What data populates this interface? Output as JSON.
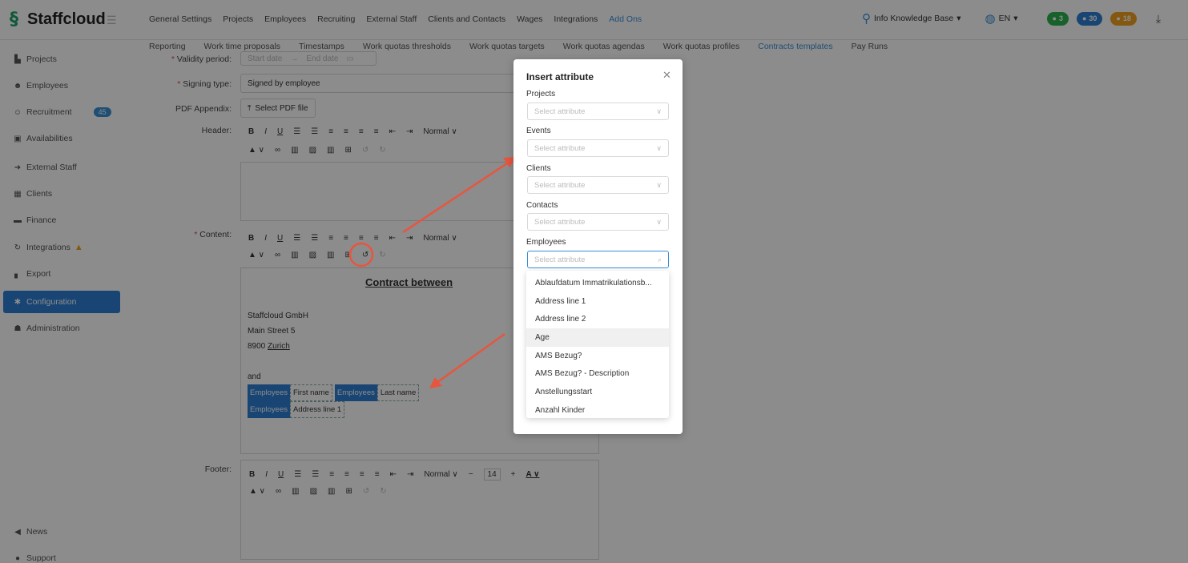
{
  "app": {
    "name": "Staffcloud"
  },
  "main_nav": [
    "General Settings",
    "Projects",
    "Employees",
    "Recruiting",
    "External Staff",
    "Clients and Contacts",
    "Wages",
    "Integrations",
    "Add Ons"
  ],
  "sub_nav": [
    "Reporting",
    "Work time proposals",
    "Timestamps",
    "Work quotas thresholds",
    "Work quotas targets",
    "Work quotas agendas",
    "Work quotas profiles",
    "Contracts templates",
    "Pay Runs"
  ],
  "top_right": {
    "user": "Info Knowledge Base",
    "lang": "EN",
    "pill_green": "3",
    "pill_blue": "30",
    "pill_orange": "18"
  },
  "sidebar": {
    "items": [
      {
        "label": "Projects",
        "icon": "chart-icon"
      },
      {
        "label": "Employees",
        "icon": "people-icon"
      },
      {
        "label": "Recruitment",
        "icon": "user-plus-icon",
        "badge": "45"
      },
      {
        "label": "Availabilities",
        "icon": "calendar-icon"
      },
      {
        "label": "External Staff",
        "icon": "login-icon"
      },
      {
        "label": "Clients",
        "icon": "building-icon"
      },
      {
        "label": "Finance",
        "icon": "money-icon"
      },
      {
        "label": "Integrations",
        "icon": "sync-icon"
      },
      {
        "label": "Export",
        "icon": "file-icon"
      },
      {
        "label": "Configuration",
        "icon": "gear-icon"
      },
      {
        "label": "Administration",
        "icon": "admin-icon"
      }
    ],
    "news": "News",
    "support": "Support"
  },
  "form": {
    "validity_label": "Validity period:",
    "start_placeholder": "Start date",
    "end_placeholder": "End date",
    "signing_label": "Signing type:",
    "signing_value": "Signed by employee",
    "pdf_label": "PDF Appendix:",
    "pdf_button": "Select PDF file",
    "header_label": "Header:",
    "content_label": "Content:",
    "footer_label": "Footer:",
    "toolbar_style": "Normal",
    "font_size": "14",
    "content": {
      "heading": "Contract between",
      "company": "Staffcloud GmbH",
      "street": "Main Street 5",
      "city": "8900",
      "city_name": "Zurich",
      "and": "and",
      "tag_entity": "Employees",
      "first_name": "First name",
      "last_name": "Last name",
      "address": "Address line 1"
    }
  },
  "modal": {
    "title": "Insert attribute",
    "sections": [
      {
        "label": "Projects",
        "placeholder": "Select attribute"
      },
      {
        "label": "Events",
        "placeholder": "Select attribute"
      },
      {
        "label": "Clients",
        "placeholder": "Select attribute"
      },
      {
        "label": "Contacts",
        "placeholder": "Select attribute"
      },
      {
        "label": "Employees",
        "placeholder": "Select attribute"
      }
    ],
    "options": [
      "Ablaufdatum Immatrikulationsb...",
      "Address line 1",
      "Address line 2",
      "Age",
      "AMS Bezug?",
      "AMS Bezug? - Description",
      "Anstellungsstart",
      "Anzahl Kinder"
    ]
  },
  "colors": {
    "accent": "#2f7fd3",
    "brand_green": "#1aa36a",
    "annotation": "#e8553e"
  }
}
